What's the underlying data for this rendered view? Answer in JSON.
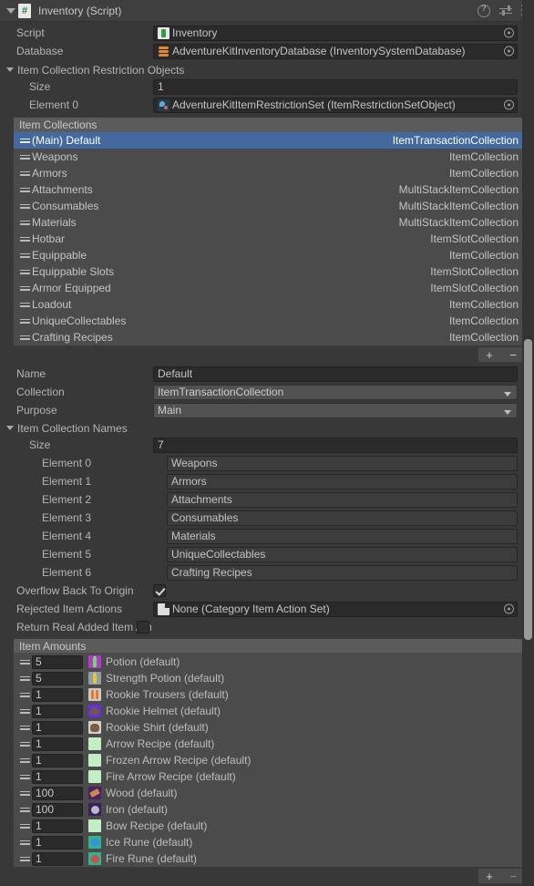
{
  "header": {
    "title": "Inventory (Script)",
    "script_icon": "csharp-script-icon",
    "help_icon": "help-icon",
    "preset_icon": "preset-icon",
    "menu_icon": "kebab-menu-icon"
  },
  "fields": {
    "script": {
      "label": "Script",
      "value": "Inventory",
      "icon": "script-asset-icon"
    },
    "database": {
      "label": "Database",
      "value": "AdventureKitInventoryDatabase (InventorySystemDatabase)",
      "icon": "database-asset-icon"
    }
  },
  "restriction_objects": {
    "label": "Item Collection Restriction Objects",
    "size_label": "Size",
    "size_value": "1",
    "elements": [
      {
        "label": "Element 0",
        "value": "AdventureKitItemRestrictionSet (ItemRestrictionSetObject)",
        "icon": "scriptable-object-icon"
      }
    ]
  },
  "item_collections": {
    "header": "Item Collections",
    "rows": [
      {
        "name": "(Main) Default",
        "type": "ItemTransactionCollection",
        "selected": true
      },
      {
        "name": "Weapons",
        "type": "ItemCollection",
        "selected": false
      },
      {
        "name": "Armors",
        "type": "ItemCollection",
        "selected": false
      },
      {
        "name": "Attachments",
        "type": "MultiStackItemCollection",
        "selected": false
      },
      {
        "name": "Consumables",
        "type": "MultiStackItemCollection",
        "selected": false
      },
      {
        "name": "Materials",
        "type": "MultiStackItemCollection",
        "selected": false
      },
      {
        "name": "Hotbar",
        "type": "ItemSlotCollection",
        "selected": false
      },
      {
        "name": "Equippable",
        "type": "ItemCollection",
        "selected": false
      },
      {
        "name": "Equippable Slots",
        "type": "ItemSlotCollection",
        "selected": false
      },
      {
        "name": "Armor Equipped",
        "type": "ItemSlotCollection",
        "selected": false
      },
      {
        "name": "Loadout",
        "type": "ItemCollection",
        "selected": false
      },
      {
        "name": "UniqueCollectables",
        "type": "ItemCollection",
        "selected": false
      },
      {
        "name": "Crafting Recipes",
        "type": "ItemCollection",
        "selected": false
      }
    ],
    "add_label": "+",
    "remove_label": "−"
  },
  "selected_collection": {
    "name": {
      "label": "Name",
      "value": "Default"
    },
    "collection": {
      "label": "Collection",
      "value": "ItemTransactionCollection"
    },
    "purpose": {
      "label": "Purpose",
      "value": "Main"
    }
  },
  "item_collection_names": {
    "label": "Item Collection Names",
    "size_label": "Size",
    "size_value": "7",
    "elements": [
      {
        "label": "Element 0",
        "value": "Weapons"
      },
      {
        "label": "Element 1",
        "value": "Armors"
      },
      {
        "label": "Element 2",
        "value": "Attachments"
      },
      {
        "label": "Element 3",
        "value": "Consumables"
      },
      {
        "label": "Element 4",
        "value": "Materials"
      },
      {
        "label": "Element 5",
        "value": "UniqueCollectables"
      },
      {
        "label": "Element 6",
        "value": "Crafting Recipes"
      }
    ]
  },
  "options": {
    "overflow": {
      "label": "Overflow Back To Origin",
      "checked": true
    },
    "rejected_actions": {
      "label": "Rejected Item Actions",
      "value": "None (Category Item Action Set)",
      "icon": "none-asset-icon"
    },
    "return_real": {
      "label": "Return Real Added Item Am",
      "checked": false
    }
  },
  "item_amounts": {
    "header": "Item Amounts",
    "rows": [
      {
        "amount": "5",
        "name": "Potion (default)",
        "icon": "potion-item-icon",
        "bg": "#b13bc4",
        "fg": "#6ddc6d"
      },
      {
        "amount": "5",
        "name": "Strength Potion (default)",
        "icon": "strength-potion-item-icon",
        "bg": "#8fa0a8",
        "fg": "#e3c63a"
      },
      {
        "amount": "1",
        "name": "Rookie Trousers (default)",
        "icon": "rookie-trousers-item-icon",
        "bg": "#c9c9c9",
        "fg": "#e8782a"
      },
      {
        "amount": "1",
        "name": "Rookie Helmet (default)",
        "icon": "rookie-helmet-item-icon",
        "bg": "#6a2de0",
        "fg": "#6d5a4a"
      },
      {
        "amount": "1",
        "name": "Rookie Shirt (default)",
        "icon": "rookie-shirt-item-icon",
        "bg": "#d6cfc6",
        "fg": "#7a5c48"
      },
      {
        "amount": "1",
        "name": "Arrow Recipe (default)",
        "icon": "arrow-recipe-item-icon",
        "bg": "#c2eec4",
        "fg": "#c2eec4"
      },
      {
        "amount": "1",
        "name": "Frozen Arrow Recipe (default)",
        "icon": "frozen-arrow-recipe-item-icon",
        "bg": "#c2eec4",
        "fg": "#c2eec4"
      },
      {
        "amount": "1",
        "name": "Fire Arrow Recipe (default)",
        "icon": "fire-arrow-recipe-item-icon",
        "bg": "#c2eec4",
        "fg": "#c2eec4"
      },
      {
        "amount": "100",
        "name": "Wood (default)",
        "icon": "wood-item-icon",
        "bg": "#4a1f6b",
        "fg": "#c98b4a"
      },
      {
        "amount": "100",
        "name": "Iron (default)",
        "icon": "iron-item-icon",
        "bg": "#3d1f5c",
        "fg": "#b9b9c4"
      },
      {
        "amount": "1",
        "name": "Bow Recipe (default)",
        "icon": "bow-recipe-item-icon",
        "bg": "#c2eec4",
        "fg": "#c2eec4"
      },
      {
        "amount": "1",
        "name": "Ice Rune (default)",
        "icon": "ice-rune-item-icon",
        "bg": "#2eb38f",
        "fg": "#3f8fe0"
      },
      {
        "amount": "1",
        "name": "Fire Rune (default)",
        "icon": "fire-rune-item-icon",
        "bg": "#2eb38f",
        "fg": "#d04b4b"
      }
    ],
    "add_label": "+",
    "remove_label": "−"
  }
}
